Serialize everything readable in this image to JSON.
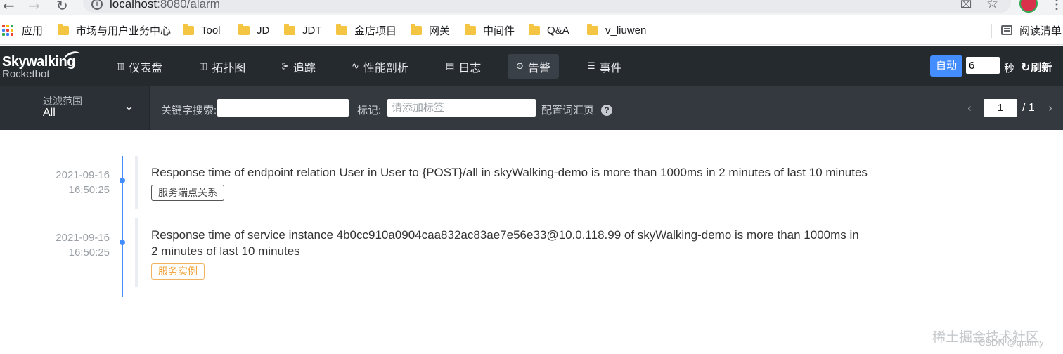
{
  "browser": {
    "back": "←",
    "forward": "→",
    "reload": "↻",
    "url_host": "localhost",
    "url_rest": ":8080/alarm",
    "star": "☆",
    "menu": "⋮"
  },
  "bookmarks": {
    "apps": "应用",
    "folders": [
      "市场与用户业务中心",
      "Tool",
      "JD",
      "JDT",
      "金店项目",
      "网关",
      "中间件",
      "Q&A",
      "v_liuwen"
    ],
    "reading_list": "阅读清单"
  },
  "logo": {
    "main": "Skywalking",
    "sub": "Rocketbot"
  },
  "menu": [
    {
      "label": "仪表盘",
      "icon": "dashboard-icon",
      "glyph": "▥"
    },
    {
      "label": "拓扑图",
      "icon": "topology-icon",
      "glyph": "◫"
    },
    {
      "label": "追踪",
      "icon": "trace-icon",
      "glyph": "⊱"
    },
    {
      "label": "性能剖析",
      "icon": "profile-icon",
      "glyph": "∿"
    },
    {
      "label": "日志",
      "icon": "log-icon",
      "glyph": "▤"
    },
    {
      "label": "告警",
      "icon": "alarm-icon",
      "glyph": "⊙"
    },
    {
      "label": "事件",
      "icon": "event-icon",
      "glyph": "☰"
    }
  ],
  "header_right": {
    "auto_label": "自动",
    "interval_value": "6",
    "sec_label": "秒",
    "refresh_label": "刷新",
    "refresh_glyph": "↻"
  },
  "filter": {
    "scope_label": "过滤范围",
    "scope_value": "All",
    "scope_chevron": "⌄",
    "keyword_label": "关键字搜索:",
    "keyword_value": "",
    "tag_label": "标记:",
    "tag_placeholder": "请添加标签",
    "config_label": "配置词汇页",
    "help": "?",
    "prev": "‹",
    "next": "›",
    "page_value": "1",
    "page_total": "/ 1"
  },
  "alarms": [
    {
      "date": "2021-09-16",
      "time": "16:50:25",
      "message": "Response time of endpoint relation User in User to {POST}/all in skyWalking-demo is more than 1000ms in 2 minutes of last 10 minutes",
      "tag": "服务端点关系"
    },
    {
      "date": "2021-09-16",
      "time": "16:50:25",
      "message": "Response time of service instance 4b0cc910a0904caa832ac83ae7e56e33@10.0.118.99 of skyWalking-demo is more than 1000ms in 2 minutes of last 10 minutes",
      "tag": "服务实例"
    }
  ],
  "watermark": "稀土掘金技术社区",
  "watermark2": "CSDN @qraimy",
  "colors": {
    "accent": "#448dfe",
    "header_bg": "#252a2f",
    "filter_bg": "#33393f",
    "tag_orange": "#f0a033"
  }
}
